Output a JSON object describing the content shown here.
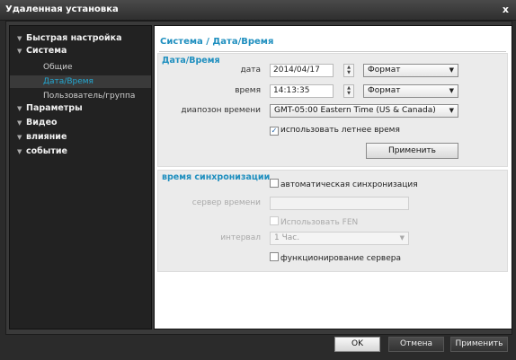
{
  "window": {
    "title": "Удаленная установка",
    "close_glyph": "x"
  },
  "sidebar": {
    "items": [
      {
        "label": "Быстрая настройка",
        "level": "top",
        "arrow": "▼"
      },
      {
        "label": "Система",
        "level": "top",
        "arrow": "▼"
      },
      {
        "label": "Общие",
        "level": "sub"
      },
      {
        "label": "Дата/Время",
        "level": "sub",
        "selected": true
      },
      {
        "label": "Пользователь/группа",
        "level": "sub"
      },
      {
        "label": "Параметры",
        "level": "top",
        "arrow": "▼"
      },
      {
        "label": "Видео",
        "level": "top",
        "arrow": "▼"
      },
      {
        "label": "влияние",
        "level": "top",
        "arrow": "▼"
      },
      {
        "label": "событие",
        "level": "top",
        "arrow": "▼"
      }
    ]
  },
  "main": {
    "breadcrumb": "Система / Дата/Время",
    "datetime": {
      "title": "Дата/Время",
      "date_label": "дата",
      "date_value": "2014/04/17",
      "date_format": "Формат",
      "time_label": "время",
      "time_value": "14:13:35",
      "time_format": "Формат",
      "tz_label": "диапозон времени",
      "tz_value": "GMT-05:00 Eastern Time (US & Canada)",
      "dst_label": "использовать летнее время",
      "dst_checked": true,
      "apply_label": "Применить"
    },
    "sync": {
      "title": "время синхронизации",
      "auto_label": "автоматическая синхронизация",
      "server_label": "сервер времени",
      "server_value": "",
      "fen_label": "Использовать FEN",
      "interval_label": "интервал",
      "interval_value": "1 Час.",
      "server_op_label": "функционирование сервера"
    }
  },
  "footer": {
    "ok": "OK",
    "cancel": "Отмена",
    "apply": "Применить"
  },
  "colors": {
    "accent": "#1f8fbf",
    "selected_text": "#23a9d4"
  }
}
